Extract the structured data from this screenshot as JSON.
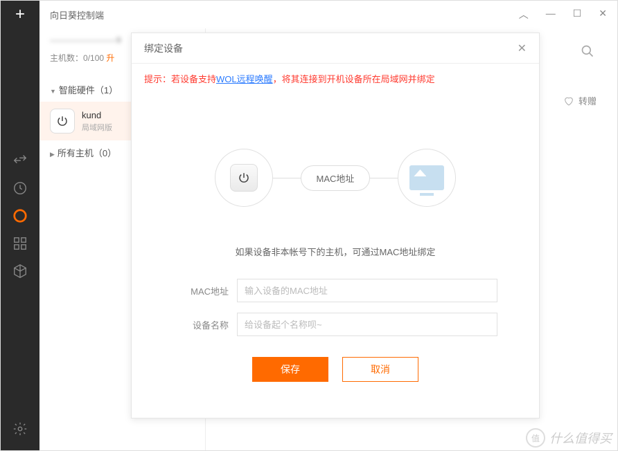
{
  "titlebar": {
    "title": "向日葵控制端"
  },
  "left_panel": {
    "account_blur": "————————9",
    "host_count_label": "主机数：",
    "host_count_value": "0/100",
    "upgrade_label": "升",
    "sections": {
      "smart_hw": "智能硬件（1）",
      "all_hosts": "所有主机（0）"
    },
    "device": {
      "name": "kund",
      "sub": "局域网版"
    }
  },
  "right_panel": {
    "gift_label": "转赠"
  },
  "modal": {
    "title": "绑定设备",
    "hint_prefix": "提示：若设备支持",
    "hint_link": "WOL远程唤醒",
    "hint_suffix": "，将其连接到开机设备所在局域网并绑定",
    "diagram_pill": "MAC地址",
    "note": "如果设备非本帐号下的主机，可通过MAC地址绑定",
    "mac_label": "MAC地址",
    "mac_placeholder": "输入设备的MAC地址",
    "name_label": "设备名称",
    "name_placeholder": "给设备起个名称呗~",
    "save": "保存",
    "cancel": "取消"
  },
  "watermark": {
    "char": "值",
    "text": "什么值得买"
  }
}
